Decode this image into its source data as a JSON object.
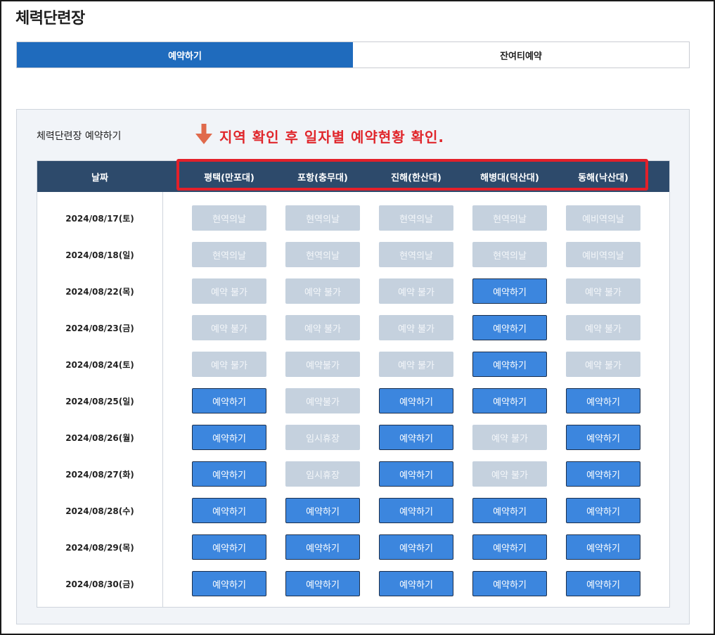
{
  "page": {
    "title": "체력단련장"
  },
  "tabs": [
    {
      "label": "예약하기",
      "active": true
    },
    {
      "label": "잔여티예약",
      "active": false
    }
  ],
  "panel": {
    "heading": "체력단련장 예약하기",
    "note": "지역 확인 후 일자별 예약현황 확인.",
    "note_icon": "down-arrow-icon"
  },
  "table": {
    "date_header": "날짜",
    "locations": [
      "평택(만포대)",
      "포항(충무대)",
      "진해(한산대)",
      "해병대(덕산대)",
      "동해(낙산대)"
    ],
    "rows": [
      {
        "date": "2024/08/17(토)",
        "cells": [
          {
            "label": "현역의날",
            "status": "disabled"
          },
          {
            "label": "현역의날",
            "status": "disabled"
          },
          {
            "label": "현역의날",
            "status": "disabled"
          },
          {
            "label": "현역의날",
            "status": "disabled"
          },
          {
            "label": "예비역의날",
            "status": "disabled"
          }
        ]
      },
      {
        "date": "2024/08/18(일)",
        "cells": [
          {
            "label": "현역의날",
            "status": "disabled"
          },
          {
            "label": "현역의날",
            "status": "disabled"
          },
          {
            "label": "현역의날",
            "status": "disabled"
          },
          {
            "label": "현역의날",
            "status": "disabled"
          },
          {
            "label": "예비역의날",
            "status": "disabled"
          }
        ]
      },
      {
        "date": "2024/08/22(목)",
        "cells": [
          {
            "label": "예약 불가",
            "status": "disabled"
          },
          {
            "label": "예약 불가",
            "status": "disabled"
          },
          {
            "label": "예약 불가",
            "status": "disabled"
          },
          {
            "label": "예약하기",
            "status": "active"
          },
          {
            "label": "예약 불가",
            "status": "disabled"
          }
        ]
      },
      {
        "date": "2024/08/23(금)",
        "cells": [
          {
            "label": "예약 불가",
            "status": "disabled"
          },
          {
            "label": "예약 불가",
            "status": "disabled"
          },
          {
            "label": "예약 불가",
            "status": "disabled"
          },
          {
            "label": "예약하기",
            "status": "active"
          },
          {
            "label": "예약 불가",
            "status": "disabled"
          }
        ]
      },
      {
        "date": "2024/08/24(토)",
        "cells": [
          {
            "label": "예약 불가",
            "status": "disabled"
          },
          {
            "label": "예약불가",
            "status": "disabled"
          },
          {
            "label": "예약 불가",
            "status": "disabled"
          },
          {
            "label": "예약하기",
            "status": "active"
          },
          {
            "label": "예약 불가",
            "status": "disabled"
          }
        ]
      },
      {
        "date": "2024/08/25(일)",
        "cells": [
          {
            "label": "예약하기",
            "status": "active"
          },
          {
            "label": "예약불가",
            "status": "disabled"
          },
          {
            "label": "예약하기",
            "status": "active"
          },
          {
            "label": "예약하기",
            "status": "active"
          },
          {
            "label": "예약하기",
            "status": "active"
          }
        ]
      },
      {
        "date": "2024/08/26(월)",
        "cells": [
          {
            "label": "예약하기",
            "status": "active"
          },
          {
            "label": "임시휴장",
            "status": "disabled"
          },
          {
            "label": "예약하기",
            "status": "active"
          },
          {
            "label": "예약 불가",
            "status": "disabled"
          },
          {
            "label": "예약하기",
            "status": "active"
          }
        ]
      },
      {
        "date": "2024/08/27(화)",
        "cells": [
          {
            "label": "예약하기",
            "status": "active"
          },
          {
            "label": "임시휴장",
            "status": "disabled"
          },
          {
            "label": "예약하기",
            "status": "active"
          },
          {
            "label": "예약 불가",
            "status": "disabled"
          },
          {
            "label": "예약하기",
            "status": "active"
          }
        ]
      },
      {
        "date": "2024/08/28(수)",
        "cells": [
          {
            "label": "예약하기",
            "status": "active"
          },
          {
            "label": "예약하기",
            "status": "active"
          },
          {
            "label": "예약하기",
            "status": "active"
          },
          {
            "label": "예약하기",
            "status": "active"
          },
          {
            "label": "예약하기",
            "status": "active"
          }
        ]
      },
      {
        "date": "2024/08/29(목)",
        "cells": [
          {
            "label": "예약하기",
            "status": "active"
          },
          {
            "label": "예약하기",
            "status": "active"
          },
          {
            "label": "예약하기",
            "status": "active"
          },
          {
            "label": "예약하기",
            "status": "active"
          },
          {
            "label": "예약하기",
            "status": "active"
          }
        ]
      },
      {
        "date": "2024/08/30(금)",
        "cells": [
          {
            "label": "예약하기",
            "status": "active"
          },
          {
            "label": "예약하기",
            "status": "active"
          },
          {
            "label": "예약하기",
            "status": "active"
          },
          {
            "label": "예약하기",
            "status": "active"
          },
          {
            "label": "예약하기",
            "status": "active"
          }
        ]
      }
    ]
  },
  "colors": {
    "tab_active": "#1f6bbd",
    "header_bg": "#2d4a6b",
    "button_active": "#3c86de",
    "button_disabled": "#c5d1de",
    "note": "#e0262b",
    "arrow": "#e06a4c"
  }
}
